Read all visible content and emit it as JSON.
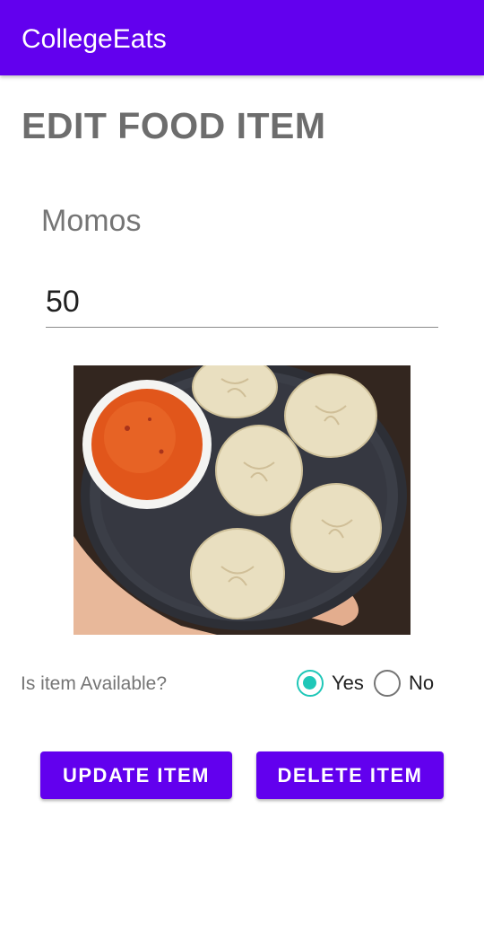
{
  "app_bar": {
    "title": "CollegeEats",
    "color": "#6200ee"
  },
  "page": {
    "title": "EDIT FOOD ITEM"
  },
  "item": {
    "name": "Momos",
    "price_value": "50",
    "image_icon": "food-photo-momos"
  },
  "availability": {
    "label": "Is item Available?",
    "options": [
      {
        "label": "Yes",
        "selected": true
      },
      {
        "label": "No",
        "selected": false
      }
    ],
    "accent_color": "#1fc7b8"
  },
  "actions": {
    "update_label": "UPDATE ITEM",
    "delete_label": "DELETE ITEM"
  }
}
